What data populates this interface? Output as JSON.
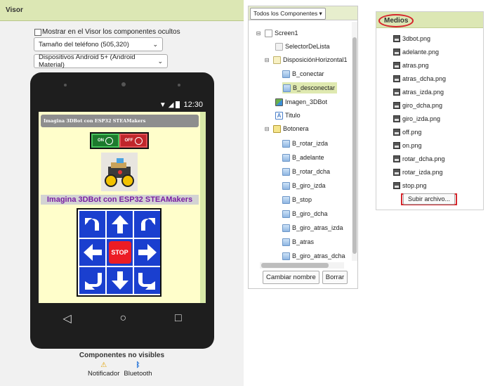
{
  "visor": {
    "title": "Visor",
    "show_hidden_label": "Mostrar en el Visor los componentes ocultos",
    "phone_size": "Tamaño del teléfono (505,320)",
    "theme": "Dispositivos Android 5+ (Android Material)",
    "status_time": "12:30",
    "app_title": "Imagina 3DBot con ESP32 STEAMakers",
    "btn_on": "ON",
    "btn_off": "OFF",
    "headline": "Imagina 3DBot con ESP32 STEAMakers",
    "stop_label": "STOP",
    "nav": {
      "back": "◁",
      "home": "○",
      "recent": "□"
    },
    "nonvisible_title": "Componentes no visibles",
    "nonvisible": [
      {
        "icon": "warning-icon",
        "label": "Notificador"
      },
      {
        "icon": "bluetooth-icon",
        "label": "Bluetooth"
      }
    ]
  },
  "components": {
    "dropdown": "Todos los Componentes ▾",
    "tree": [
      {
        "label": "Screen1",
        "toggle": "⊟"
      },
      {
        "label": "SelectorDeLista",
        "toggle": ""
      },
      {
        "label": "DisposiciónHorizontal1",
        "toggle": "⊟"
      },
      {
        "label": "B_conectar",
        "toggle": ""
      },
      {
        "label": "B_desconectar",
        "toggle": "",
        "selected": true
      },
      {
        "label": "Imagen_3DBot",
        "toggle": ""
      },
      {
        "label": "Titulo",
        "toggle": ""
      },
      {
        "label": "Botonera",
        "toggle": "⊟"
      },
      {
        "label": "B_rotar_izda",
        "toggle": ""
      },
      {
        "label": "B_adelante",
        "toggle": ""
      },
      {
        "label": "B_rotar_dcha",
        "toggle": ""
      },
      {
        "label": "B_giro_izda",
        "toggle": ""
      },
      {
        "label": "B_stop",
        "toggle": ""
      },
      {
        "label": "B_giro_dcha",
        "toggle": ""
      },
      {
        "label": "B_giro_atras_izda",
        "toggle": ""
      },
      {
        "label": "B_atras",
        "toggle": ""
      },
      {
        "label": "B_giro_atras_dcha",
        "toggle": ""
      }
    ],
    "rename_button": "Cambiar nombre",
    "delete_button": "Borrar"
  },
  "media": {
    "title": "Medios",
    "files": [
      "3dbot.png",
      "adelante.png",
      "atras.png",
      "atras_dcha.png",
      "atras_izda.png",
      "giro_dcha.png",
      "giro_izda.png",
      "off.png",
      "on.png",
      "rotar_dcha.png",
      "rotar_izda.png",
      "stop.png"
    ],
    "upload_button": "Subir archivo..."
  },
  "colors": {
    "panel_header": "#dce7b4",
    "screen_bg": "#fffecb",
    "pad_blue": "#1a3fcf",
    "stop_red": "#ec1c24",
    "headline_purple": "#7a1fa2",
    "highlight_red": "#d6262c"
  }
}
